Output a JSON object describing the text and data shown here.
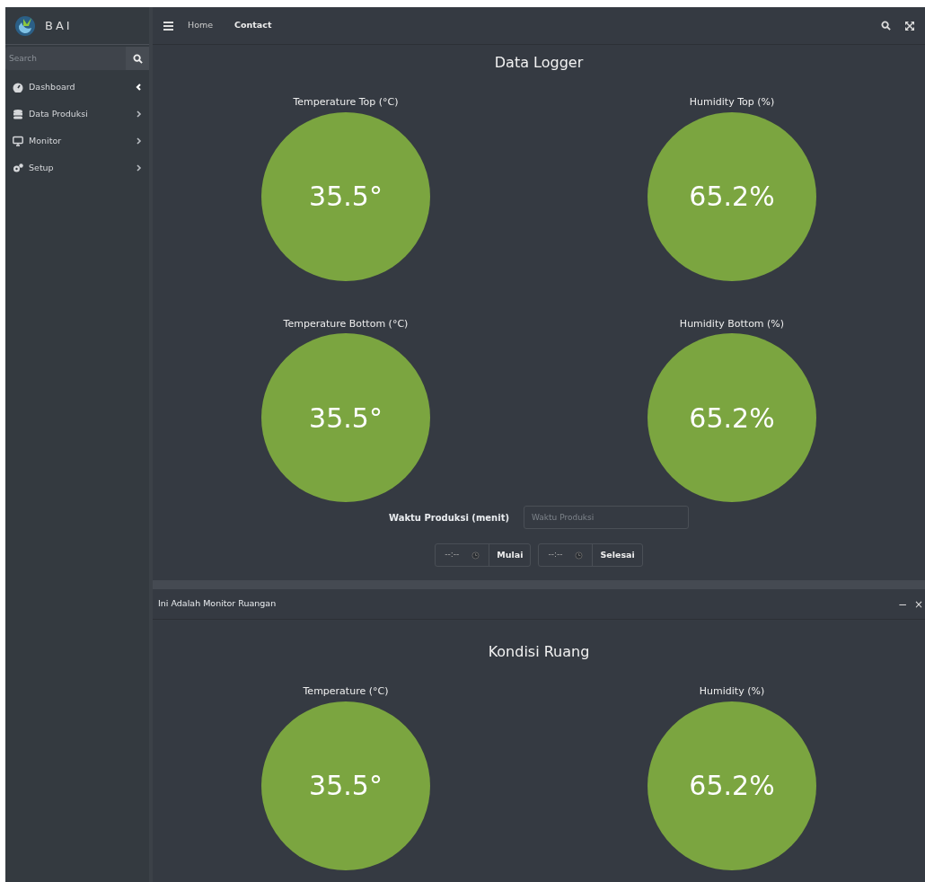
{
  "brand": {
    "name": "BAI"
  },
  "sidebar": {
    "search": {
      "placeholder": "Search"
    },
    "items": [
      {
        "label": "Dashboard",
        "active": true
      },
      {
        "label": "Data Produksi",
        "active": false
      },
      {
        "label": "Monitor",
        "active": false
      },
      {
        "label": "Setup",
        "active": false
      }
    ]
  },
  "navbar": {
    "links": [
      "Home",
      "Contact"
    ]
  },
  "data_logger": {
    "title": "Data Logger",
    "gauges": [
      {
        "title": "Temperature Top (°C)",
        "value": "35.5°"
      },
      {
        "title": "Humidity Top (%)",
        "value": "65.2%"
      },
      {
        "title": "Temperature Bottom (°C)",
        "value": "35.5°"
      },
      {
        "title": "Humidity Bottom (%)",
        "value": "65.2%"
      }
    ],
    "production_time": {
      "label": "Waktu Produksi (menit)",
      "placeholder": "Waktu Produksi"
    },
    "time_inputs": [
      {
        "value": "--:--",
        "button": "Mulai"
      },
      {
        "value": "--:--",
        "button": "Selesai"
      }
    ]
  },
  "room_monitor": {
    "header": "Ini Adalah Monitor Ruangan",
    "header_buttons": [
      "−",
      "×"
    ],
    "title": "Kondisi Ruang",
    "gauges": [
      {
        "title": "Temperature (°C)",
        "value": "35.5°"
      },
      {
        "title": "Humidity (%)",
        "value": "65.2%"
      }
    ]
  }
}
